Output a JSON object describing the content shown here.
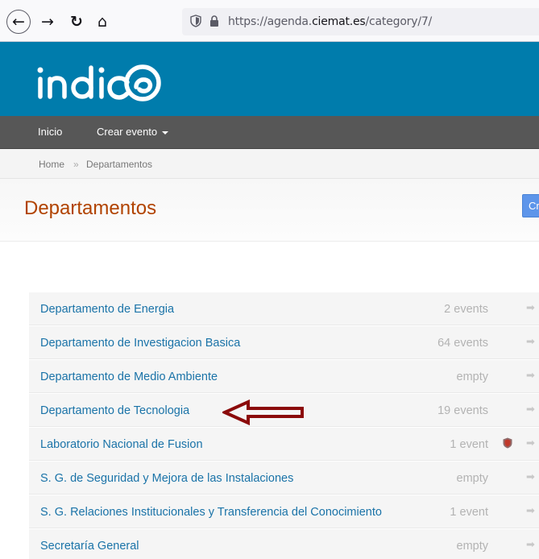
{
  "browser": {
    "back_icon": "arrow-left-icon",
    "forward_icon": "arrow-right-icon",
    "reload_icon": "reload-icon",
    "home_icon": "home-icon",
    "url_prefix": "https://agenda.",
    "url_domain": "ciemat.es",
    "url_suffix": "/category/7/"
  },
  "header": {
    "logo_text": "indico"
  },
  "menu": {
    "items": [
      {
        "label": "Inicio"
      },
      {
        "label": "Crear evento"
      }
    ]
  },
  "breadcrumb": {
    "home": "Home",
    "separator": "»",
    "current": "Departamentos"
  },
  "page": {
    "title": "Departamentos",
    "button_label": "Crear"
  },
  "categories": [
    {
      "name": "Departamento de Energia",
      "count": "2 events"
    },
    {
      "name": "Departamento de Investigacion Basica",
      "count": "64 events"
    },
    {
      "name": "Departamento de Medio Ambiente",
      "count": "empty"
    },
    {
      "name": "Departamento de Tecnologia",
      "count": "19 events"
    },
    {
      "name": "Laboratorio Nacional de Fusion",
      "count": "1 event",
      "protected": true
    },
    {
      "name": "S. G. de Seguridad y Mejora de las Instalaciones",
      "count": "empty"
    },
    {
      "name": "S. G. Relaciones Institucionales y Transferencia del Conocimiento",
      "count": "1 event"
    },
    {
      "name": "Secretaría General",
      "count": "empty"
    }
  ],
  "colors": {
    "header_blue": "#007cac",
    "menu_gray": "#575757",
    "title_orange": "#b14300",
    "link_blue": "#1a73a8",
    "annotation_red": "#8b0a0a"
  }
}
